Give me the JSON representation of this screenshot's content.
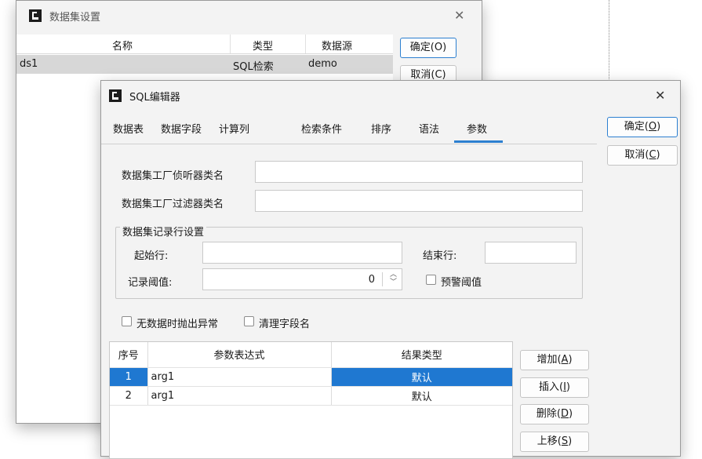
{
  "dataset_dialog": {
    "title": "数据集设置",
    "columns": [
      "名称",
      "类型",
      "数据源"
    ],
    "rows": [
      {
        "name": "ds1",
        "type": "SQL检索",
        "source": "demo"
      }
    ],
    "ok_label": "确定(O)",
    "cancel_label": "取消(C)"
  },
  "sql_editor": {
    "title": "SQL编辑器",
    "tabs": [
      "数据表",
      "数据字段",
      "计算列",
      "检索条件",
      "排序",
      "语法",
      "参数"
    ],
    "active_tab": "参数",
    "ok_label": "确定(",
    "ok_key": "O",
    "cancel_label": "取消(",
    "cancel_key": "C",
    "close_paren": ")",
    "listener_label": "数据集工厂侦听器类名",
    "listener_value": "",
    "filter_label": "数据集工厂过滤器类名",
    "filter_value": "",
    "record_group": {
      "title": "数据集记录行设置",
      "start_label": "起始行:",
      "start_value": "",
      "end_label": "结束行:",
      "end_value": "",
      "threshold_label": "记录阈值:",
      "threshold_value": "0",
      "warn_label": "预警阈值"
    },
    "throw_on_empty_label": "无数据时抛出异常",
    "clean_fields_label": "清理字段名",
    "param_table": {
      "columns": [
        "序号",
        "参数表达式",
        "结果类型"
      ],
      "rows": [
        {
          "no": "1",
          "expr": "arg1",
          "type": "默认"
        },
        {
          "no": "2",
          "expr": "arg1",
          "type": "默认"
        }
      ]
    },
    "side_buttons": [
      {
        "label": "增加(",
        "key": "A"
      },
      {
        "label": "插入(",
        "key": "I"
      },
      {
        "label": "删除(",
        "key": "D"
      },
      {
        "label": "上移(",
        "key": "S"
      }
    ]
  },
  "colors": {
    "accent": "#2c7fd0",
    "selection": "#1f78d1"
  }
}
